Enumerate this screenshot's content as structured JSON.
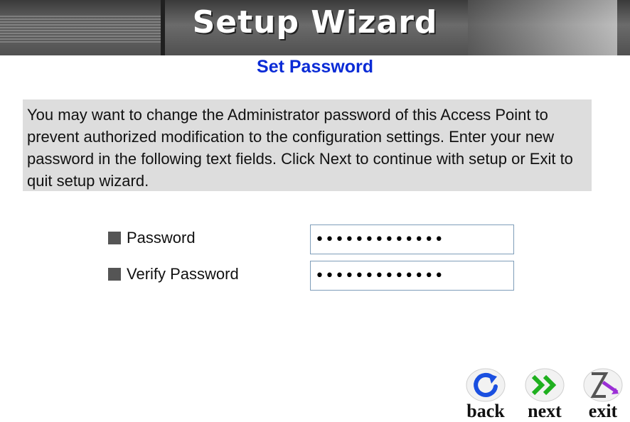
{
  "banner": {
    "title": "Setup Wizard"
  },
  "page": {
    "subtitle": "Set Password"
  },
  "description": "You may want to change the Administrator password of this Access Point to prevent authorized modification to the configuration settings. Enter your new password in the following text fields. Click Next to continue with setup or Exit to quit setup wizard.",
  "form": {
    "password": {
      "label": "Password",
      "value": "passwordpassw"
    },
    "verify": {
      "label": "Verify Password",
      "value": "passwordpassw"
    }
  },
  "nav": {
    "back": {
      "label": "back",
      "icon": "back-arrow-icon",
      "color": "#1a4fe0"
    },
    "next": {
      "label": "next",
      "icon": "double-chevron-right-icon",
      "color": "#1fb01f"
    },
    "exit": {
      "label": "exit",
      "icon": "exit-arrow-icon",
      "color": "#9b2fd6"
    }
  }
}
